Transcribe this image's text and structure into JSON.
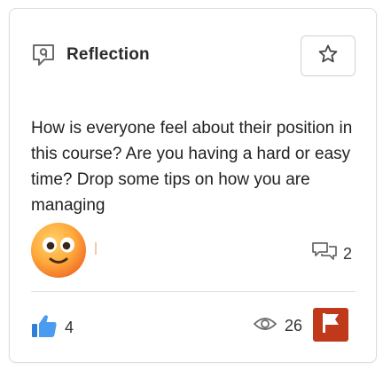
{
  "post": {
    "type_label": "Reflection",
    "type_icon": "reflection-speech-icon",
    "body": "How is everyone feel about their position in this course? Are you having a hard or easy time? Drop some tips on how you are managing",
    "avatar_icon": "smiling-face-emoji",
    "comments": {
      "count": "2",
      "icon": "comments-icon"
    },
    "likes": {
      "count": "4",
      "icon": "thumbs-up-icon"
    },
    "views": {
      "count": "26",
      "icon": "eye-icon"
    },
    "actions": {
      "favorite_icon": "star-icon",
      "report_icon": "flag-icon"
    }
  },
  "colors": {
    "like_blue": "#3a8ee6",
    "flag_red": "#c0391a",
    "icon_gray": "#6b6b6b"
  }
}
